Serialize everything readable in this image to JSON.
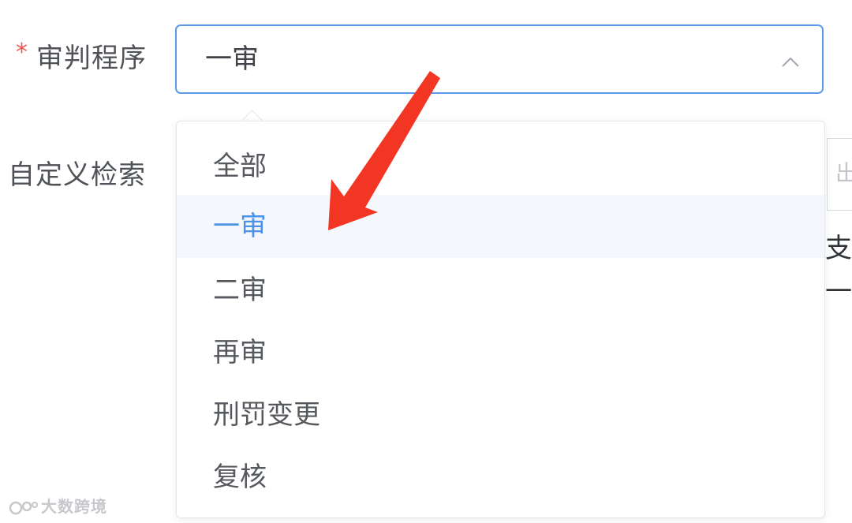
{
  "form": {
    "required_mark": "*",
    "procedure_label": "审判程序",
    "custom_search_label": "自定义检索"
  },
  "select": {
    "value": "一审",
    "icon": "chevron-up-icon",
    "options": [
      {
        "label": "全部"
      },
      {
        "label": "一审"
      },
      {
        "label": "二审"
      },
      {
        "label": "再审"
      },
      {
        "label": "刑罚变更"
      },
      {
        "label": "复核"
      }
    ],
    "selected_index": 1
  },
  "right_edge": {
    "input_glyph": "出",
    "text_1": "支",
    "text_2": "一"
  },
  "annotation": {
    "arrow_color": "#f33524"
  },
  "colors": {
    "accent": "#5d9bea",
    "selected_text": "#4c92e6",
    "required": "#f2574f"
  },
  "watermark": {
    "text": "大数跨境"
  }
}
